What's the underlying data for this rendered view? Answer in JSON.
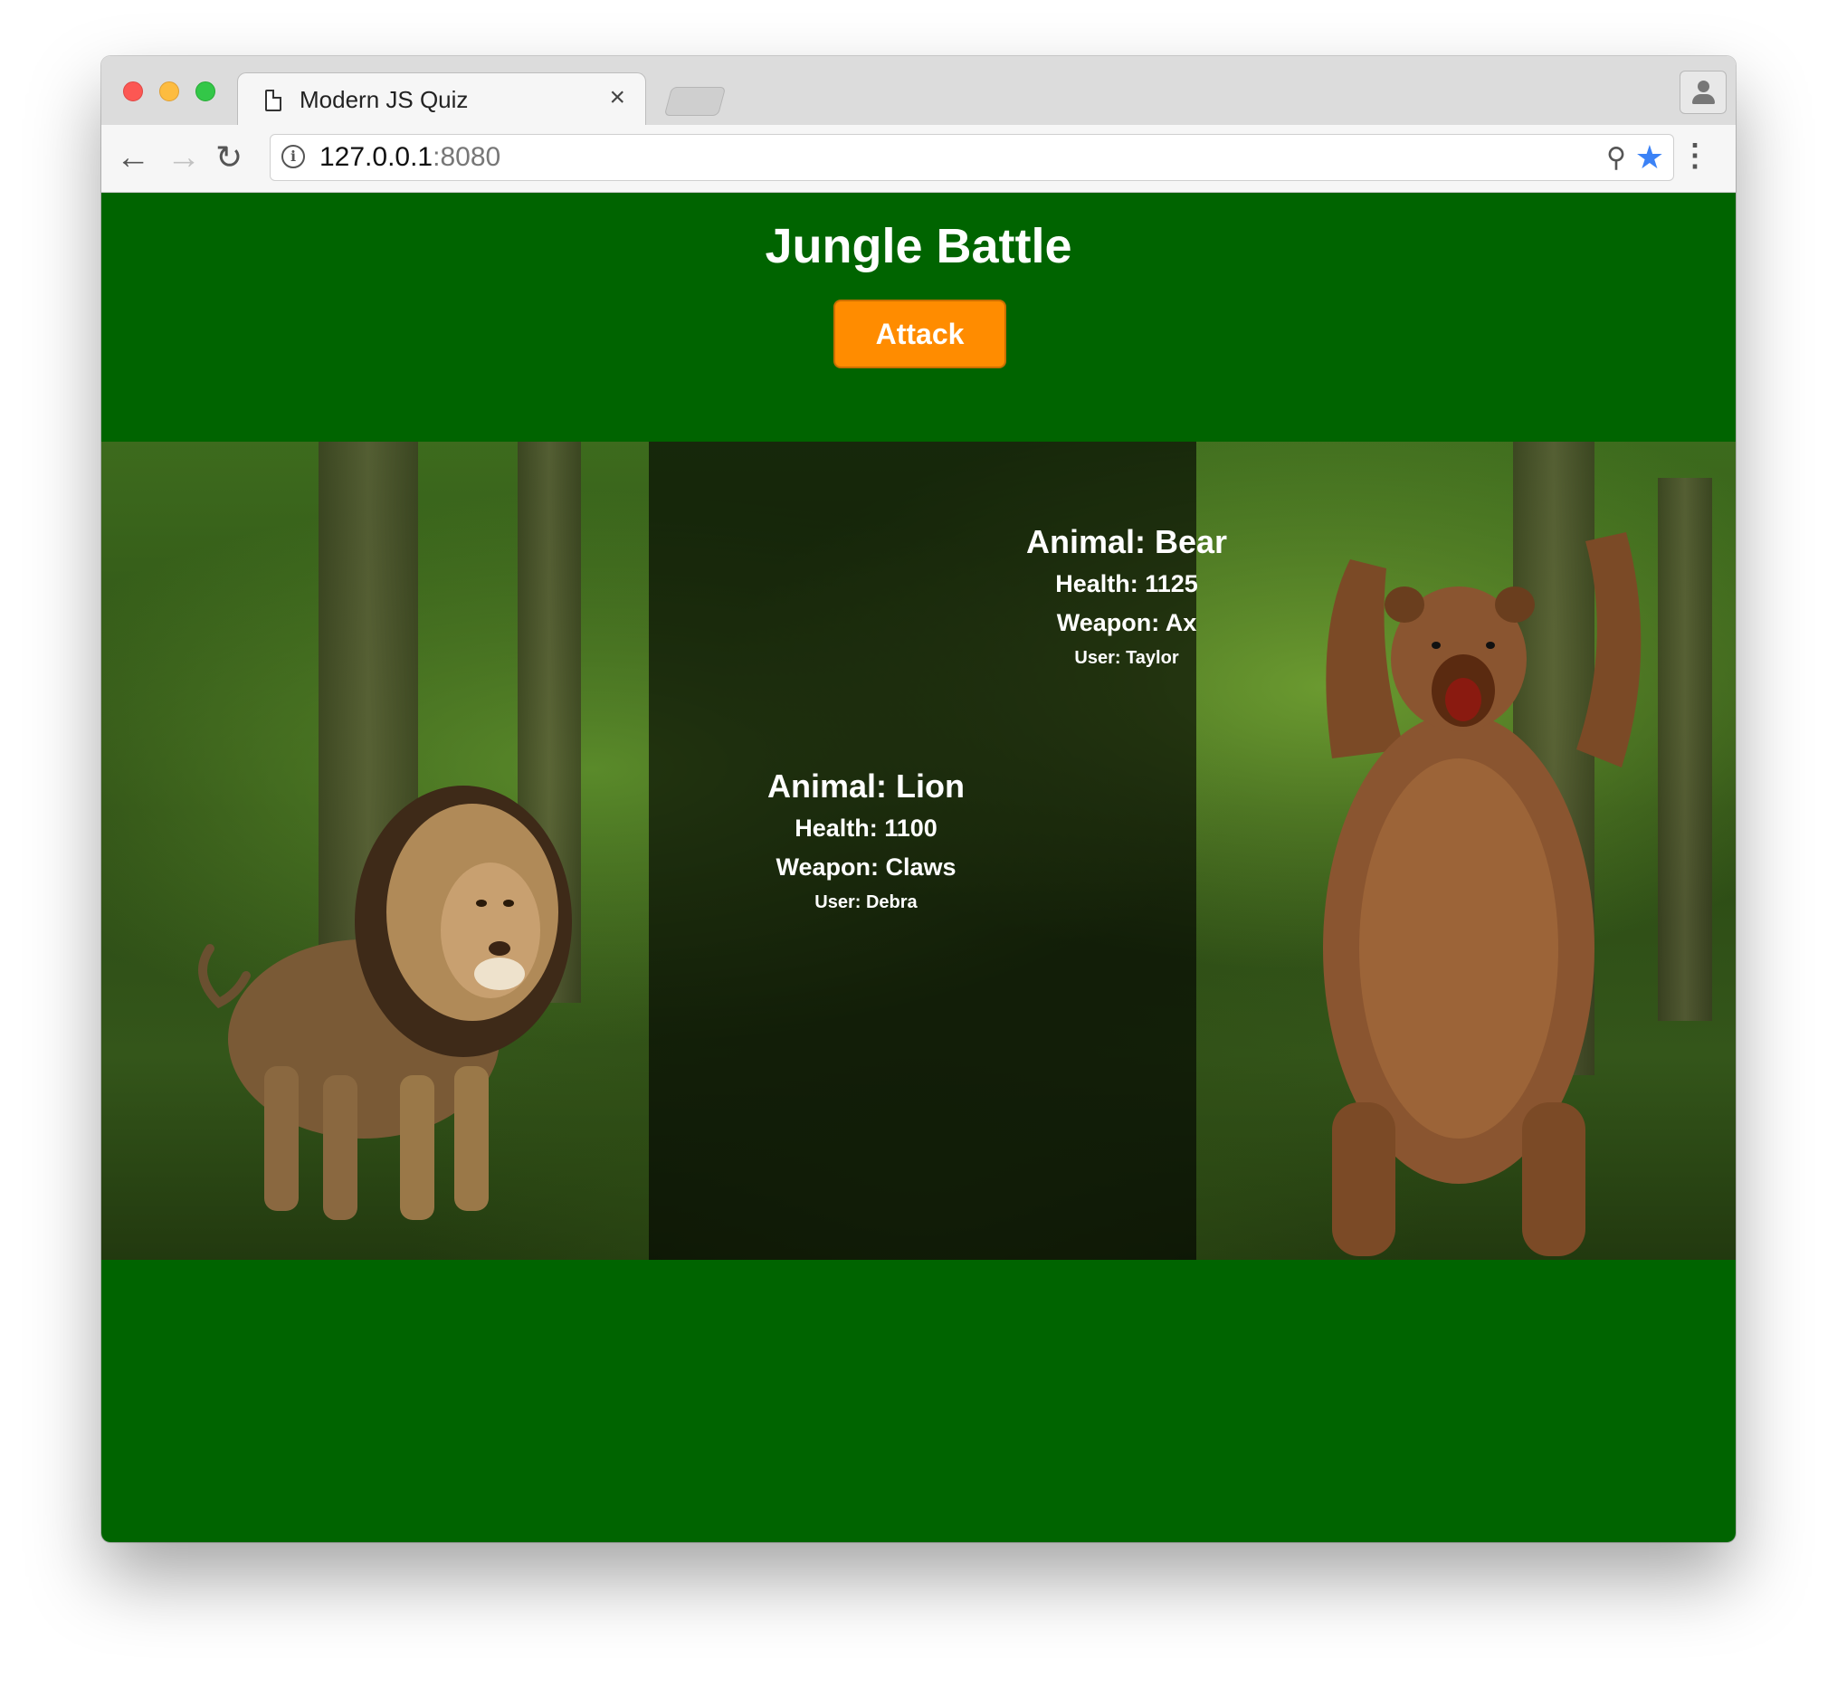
{
  "browser": {
    "tab_title": "Modern JS Quiz",
    "tab_close": "×",
    "url_host": "127.0.0.1",
    "url_port": ":8080"
  },
  "page": {
    "title": "Jungle Battle",
    "attack_label": "Attack",
    "background_color": "#006400",
    "button_color": "#ff8c00"
  },
  "fighters": [
    {
      "animal": "Animal: Lion",
      "health": "Health: 1100",
      "weapon": "Weapon: Claws",
      "user": "User: Debra"
    },
    {
      "animal": "Animal: Bear",
      "health": "Health: 1125",
      "weapon": "Weapon: Ax",
      "user": "User: Taylor"
    }
  ],
  "icons": {
    "back": "arrow-left-icon",
    "forward": "arrow-right-icon",
    "reload": "reload-icon",
    "info": "info-icon",
    "zoom": "zoom-out-icon",
    "bookmark": "star-icon",
    "menu": "kebab-menu-icon",
    "profile": "profile-icon",
    "page": "page-icon"
  }
}
